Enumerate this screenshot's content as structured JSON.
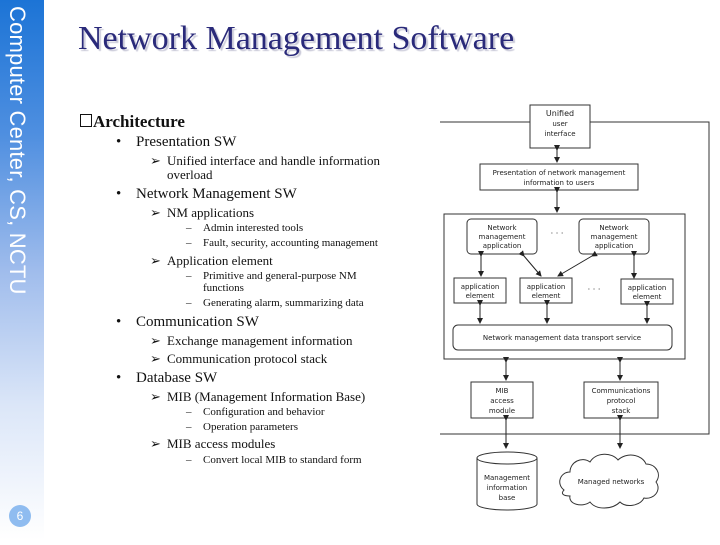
{
  "sidebar": {
    "text": "Computer Center, CS, NCTU",
    "page_number": "6",
    "gradient_top": "#1c74d6",
    "gradient_bottom": "#ffffff"
  },
  "title": "Network Management Software",
  "title_color": "#2a2a7a",
  "outline": {
    "heading": "Architecture",
    "items": [
      {
        "label": "Presentation SW",
        "children": [
          {
            "label": "Unified interface and handle information",
            "continuation": "overload",
            "children": []
          }
        ]
      },
      {
        "label": "Network Management SW",
        "children": [
          {
            "label": "NM applications",
            "children": [
              {
                "label": "Admin interested tools"
              },
              {
                "label": "Fault, security, accounting  management"
              }
            ]
          },
          {
            "label": "Application element",
            "children": [
              {
                "label": "Primitive and general-purpose NM",
                "continuation": "functions"
              },
              {
                "label": "Generating alarm, summarizing data"
              }
            ]
          }
        ]
      },
      {
        "label": "Communication SW",
        "children": [
          {
            "label": "Exchange management information",
            "children": []
          },
          {
            "label": "Communication protocol stack",
            "children": []
          }
        ]
      },
      {
        "label": "Database SW",
        "children": [
          {
            "label": "MIB (Management Information Base)",
            "children": [
              {
                "label": "Configuration and behavior"
              },
              {
                "label": "Operation parameters"
              }
            ]
          },
          {
            "label": "MIB access modules",
            "children": [
              {
                "label": "Convert local MIB to standard form"
              }
            ]
          }
        ]
      }
    ],
    "symbols": {
      "bullet": "•",
      "arrow": "➢",
      "dash": "–"
    }
  },
  "diagram": {
    "unified_ui": [
      "Unified",
      "user",
      "interface"
    ],
    "presentation": [
      "Presentation of network management",
      "information to users"
    ],
    "nm_app_left": [
      "Network",
      "management",
      "application"
    ],
    "nm_app_right": [
      "Network",
      "management",
      "application"
    ],
    "app_elements": [
      [
        "application",
        "element"
      ],
      [
        "application",
        "element"
      ],
      [
        "application",
        "element"
      ]
    ],
    "ellipsis": "· · ·",
    "transport": "Network management data transport service",
    "mib_access": [
      "MIB",
      "access",
      "module"
    ],
    "comm_stack": [
      "Communications",
      "protocol",
      "stack"
    ],
    "mib_db": [
      "Management",
      "information",
      "base"
    ],
    "managed_networks": "Managed networks"
  }
}
